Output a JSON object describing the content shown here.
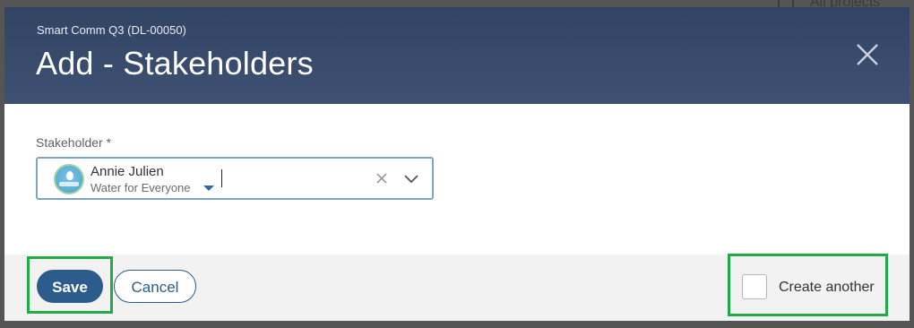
{
  "background": {
    "peek_text": "All projects"
  },
  "modal": {
    "subtitle": "Smart Comm Q3 (DL-00050)",
    "title": "Add - Stakeholders",
    "close_icon": "close-icon"
  },
  "form": {
    "stakeholder_label": "Stakeholder *",
    "selected": {
      "name": "Annie Julien",
      "organization": "Water for Everyone"
    }
  },
  "footer": {
    "save_label": "Save",
    "cancel_label": "Cancel",
    "create_another_label": "Create another",
    "create_another_checked": false
  },
  "colors": {
    "header_bg": "#3a4c6c",
    "primary": "#2b5c8c",
    "highlight": "#22aa44",
    "input_border": "#7aa5c9"
  }
}
